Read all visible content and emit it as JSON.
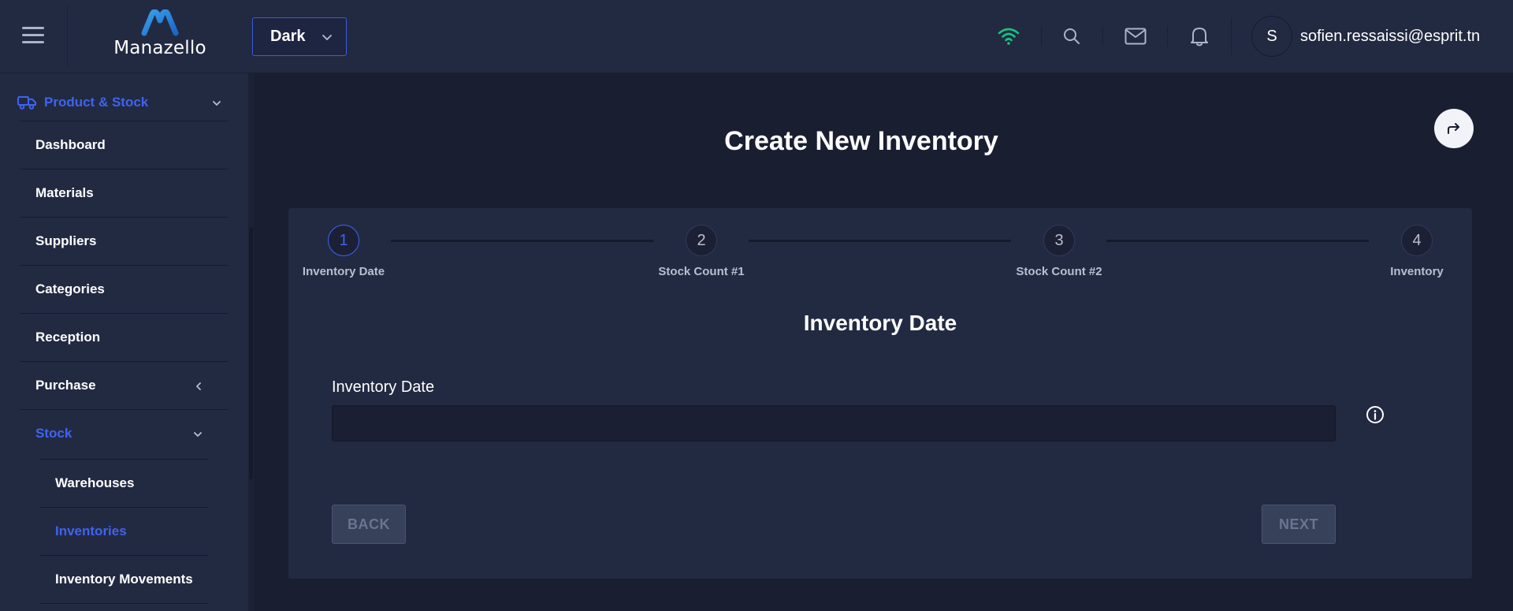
{
  "app": {
    "brand": "Manazello"
  },
  "header": {
    "theme_value": "Dark",
    "user": {
      "initial": "S",
      "email": "sofien.ressaissi@esprit.tn"
    },
    "icons": [
      "menu-icon",
      "wifi-icon",
      "search-icon",
      "mail-icon",
      "bell-icon",
      "chevron-down-icon"
    ]
  },
  "sidebar": {
    "section": {
      "label": "Product & Stock"
    },
    "items": [
      {
        "label": "Dashboard"
      },
      {
        "label": "Materials"
      },
      {
        "label": "Suppliers"
      },
      {
        "label": "Categories"
      },
      {
        "label": "Reception"
      },
      {
        "label": "Purchase"
      },
      {
        "label": "Stock"
      }
    ],
    "stock_children": [
      {
        "label": "Warehouses"
      },
      {
        "label": "Inventories"
      },
      {
        "label": "Inventory Movements"
      }
    ],
    "active_item": "Inventories"
  },
  "main": {
    "title": "Create New Inventory",
    "steps": [
      {
        "number": "1",
        "label": "Inventory Date"
      },
      {
        "number": "2",
        "label": "Stock Count #1"
      },
      {
        "number": "3",
        "label": "Stock Count #2"
      },
      {
        "number": "4",
        "label": "Inventory"
      }
    ],
    "current_step": 1,
    "section_title": "Inventory Date",
    "field": {
      "label": "Inventory Date",
      "value": "",
      "placeholder": ""
    },
    "buttons": {
      "back": "BACK",
      "next": "NEXT"
    }
  },
  "colors": {
    "accent": "#3f63f0",
    "wifi": "#19c37d",
    "background": "#1a1e31",
    "panel": "#222a42"
  }
}
